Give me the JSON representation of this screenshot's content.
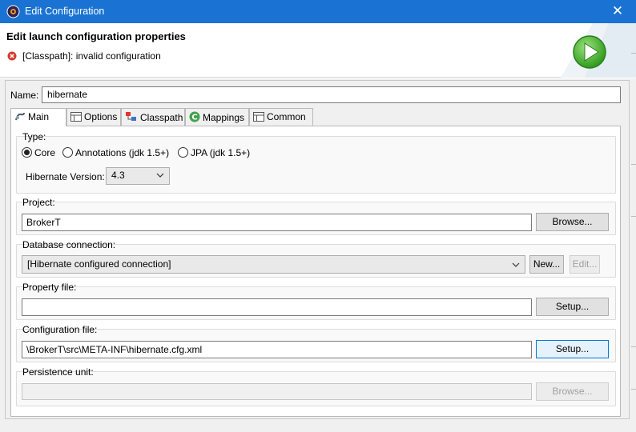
{
  "window": {
    "title": "Edit Configuration",
    "close_glyph": "✕"
  },
  "header": {
    "title": "Edit launch configuration properties",
    "error_message": "[Classpath]: invalid configuration",
    "error_icon": "error-circle-icon",
    "run_icon": "run-play-icon"
  },
  "name_field": {
    "label": "Name:",
    "value": "hibernate"
  },
  "tabs": [
    {
      "label": "Main",
      "icon": "main-tab-icon",
      "active": true
    },
    {
      "label": "Options",
      "icon": "options-table-icon"
    },
    {
      "label": "Classpath",
      "icon": "classpath-icon"
    },
    {
      "label": "Mappings",
      "icon": "mappings-c-icon"
    },
    {
      "label": "Common",
      "icon": "common-table-icon"
    }
  ],
  "type_group": {
    "label": "Type:",
    "options": [
      {
        "label": "Core",
        "selected": true
      },
      {
        "label": "Annotations (jdk 1.5+)",
        "selected": false
      },
      {
        "label": "JPA (jdk 1.5+)",
        "selected": false
      }
    ],
    "version_label": "Hibernate Version:",
    "version_value": "4.3"
  },
  "project_group": {
    "label": "Project:",
    "value": "BrokerT",
    "button": "Browse..."
  },
  "database_group": {
    "label": "Database connection:",
    "value": "[Hibernate configured connection]",
    "new_button": "New...",
    "edit_button": "Edit..."
  },
  "property_group": {
    "label": "Property file:",
    "value": "",
    "button": "Setup..."
  },
  "config_group": {
    "label": "Configuration file:",
    "value": "\\BrokerT\\src\\META-INF\\hibernate.cfg.xml",
    "button": "Setup..."
  },
  "persistence_group": {
    "label": "Persistence unit:",
    "value": "",
    "button": "Browse..."
  },
  "colors": {
    "titlebar": "#1a73d2",
    "focus_accent": "#0078d7",
    "error": "#d9382f",
    "run_green": "#3fae2a"
  }
}
